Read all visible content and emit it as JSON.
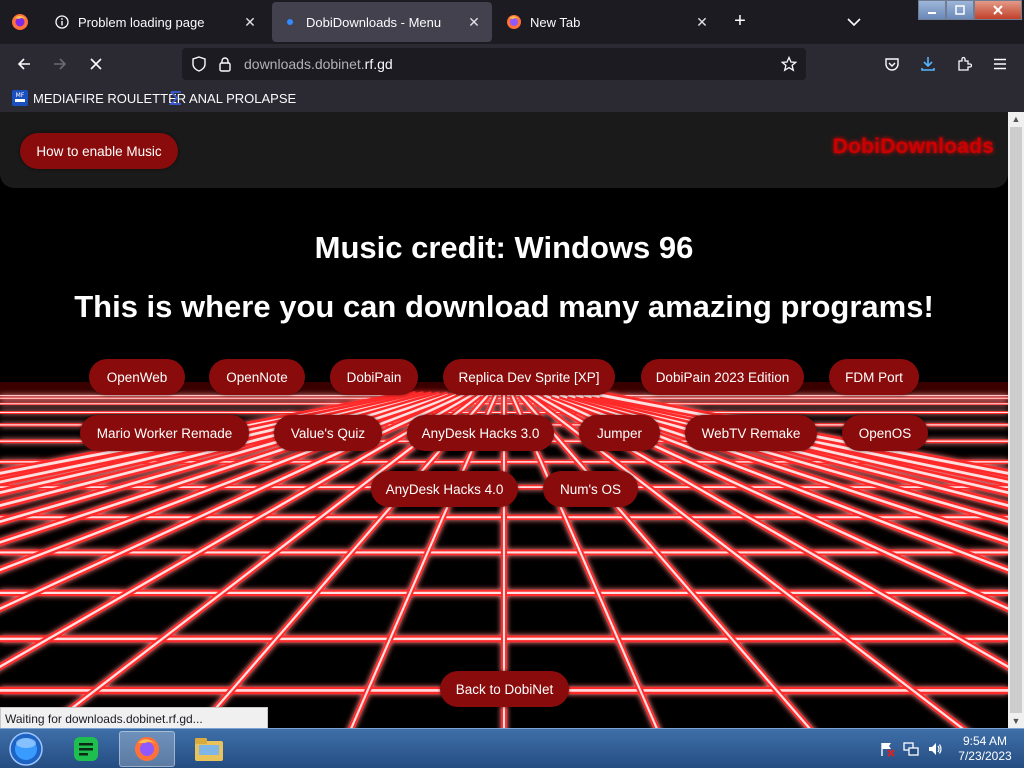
{
  "browser": {
    "tabs": [
      {
        "title": "Problem loading page",
        "icon": "info-icon",
        "active": false
      },
      {
        "title": "DobiDownloads - Menu",
        "icon": "loading-dot-icon",
        "active": true
      },
      {
        "title": "New Tab",
        "icon": "firefox-icon",
        "active": false
      }
    ],
    "new_tab_label": "+",
    "close_glyph": "✕",
    "url": {
      "host": "downloads.dobinet.",
      "tld": "rf.gd"
    },
    "bookmarks": [
      {
        "label": "MEDIAFIRE ROULETTER",
        "icon": "mediafire-icon"
      },
      {
        "label": "ANAL PROLAPSE",
        "icon": "sigma-icon"
      }
    ],
    "status_text": "Waiting for downloads.dobinet.rf.gd..."
  },
  "page": {
    "music_button": "How to enable Music",
    "brand": "DobiDownloads",
    "credit": "Music credit: Windows 96",
    "tagline": "This is where you can download many amazing programs!",
    "programs": [
      "OpenWeb",
      "OpenNote",
      "DobiPain",
      "Replica Dev Sprite [XP]",
      "DobiPain 2023 Edition",
      "FDM Port",
      "Mario Worker Remade",
      "Value's Quiz",
      "AnyDesk Hacks 3.0",
      "Jumper",
      "WebTV Remake",
      "OpenOS",
      "AnyDesk Hacks 4.0",
      "Num's OS"
    ],
    "back_button": "Back to DobiNet",
    "colors": {
      "accent": "#8a0b0b",
      "grid": "#ff2a2a",
      "brand": "#cc0000"
    }
  },
  "taskbar": {
    "items": [
      {
        "name": "start-orb-icon"
      },
      {
        "name": "notes-app-icon"
      },
      {
        "name": "firefox-taskbar-icon",
        "active": true
      },
      {
        "name": "file-explorer-icon"
      }
    ],
    "time": "9:54 AM",
    "date": "7/23/2023"
  }
}
